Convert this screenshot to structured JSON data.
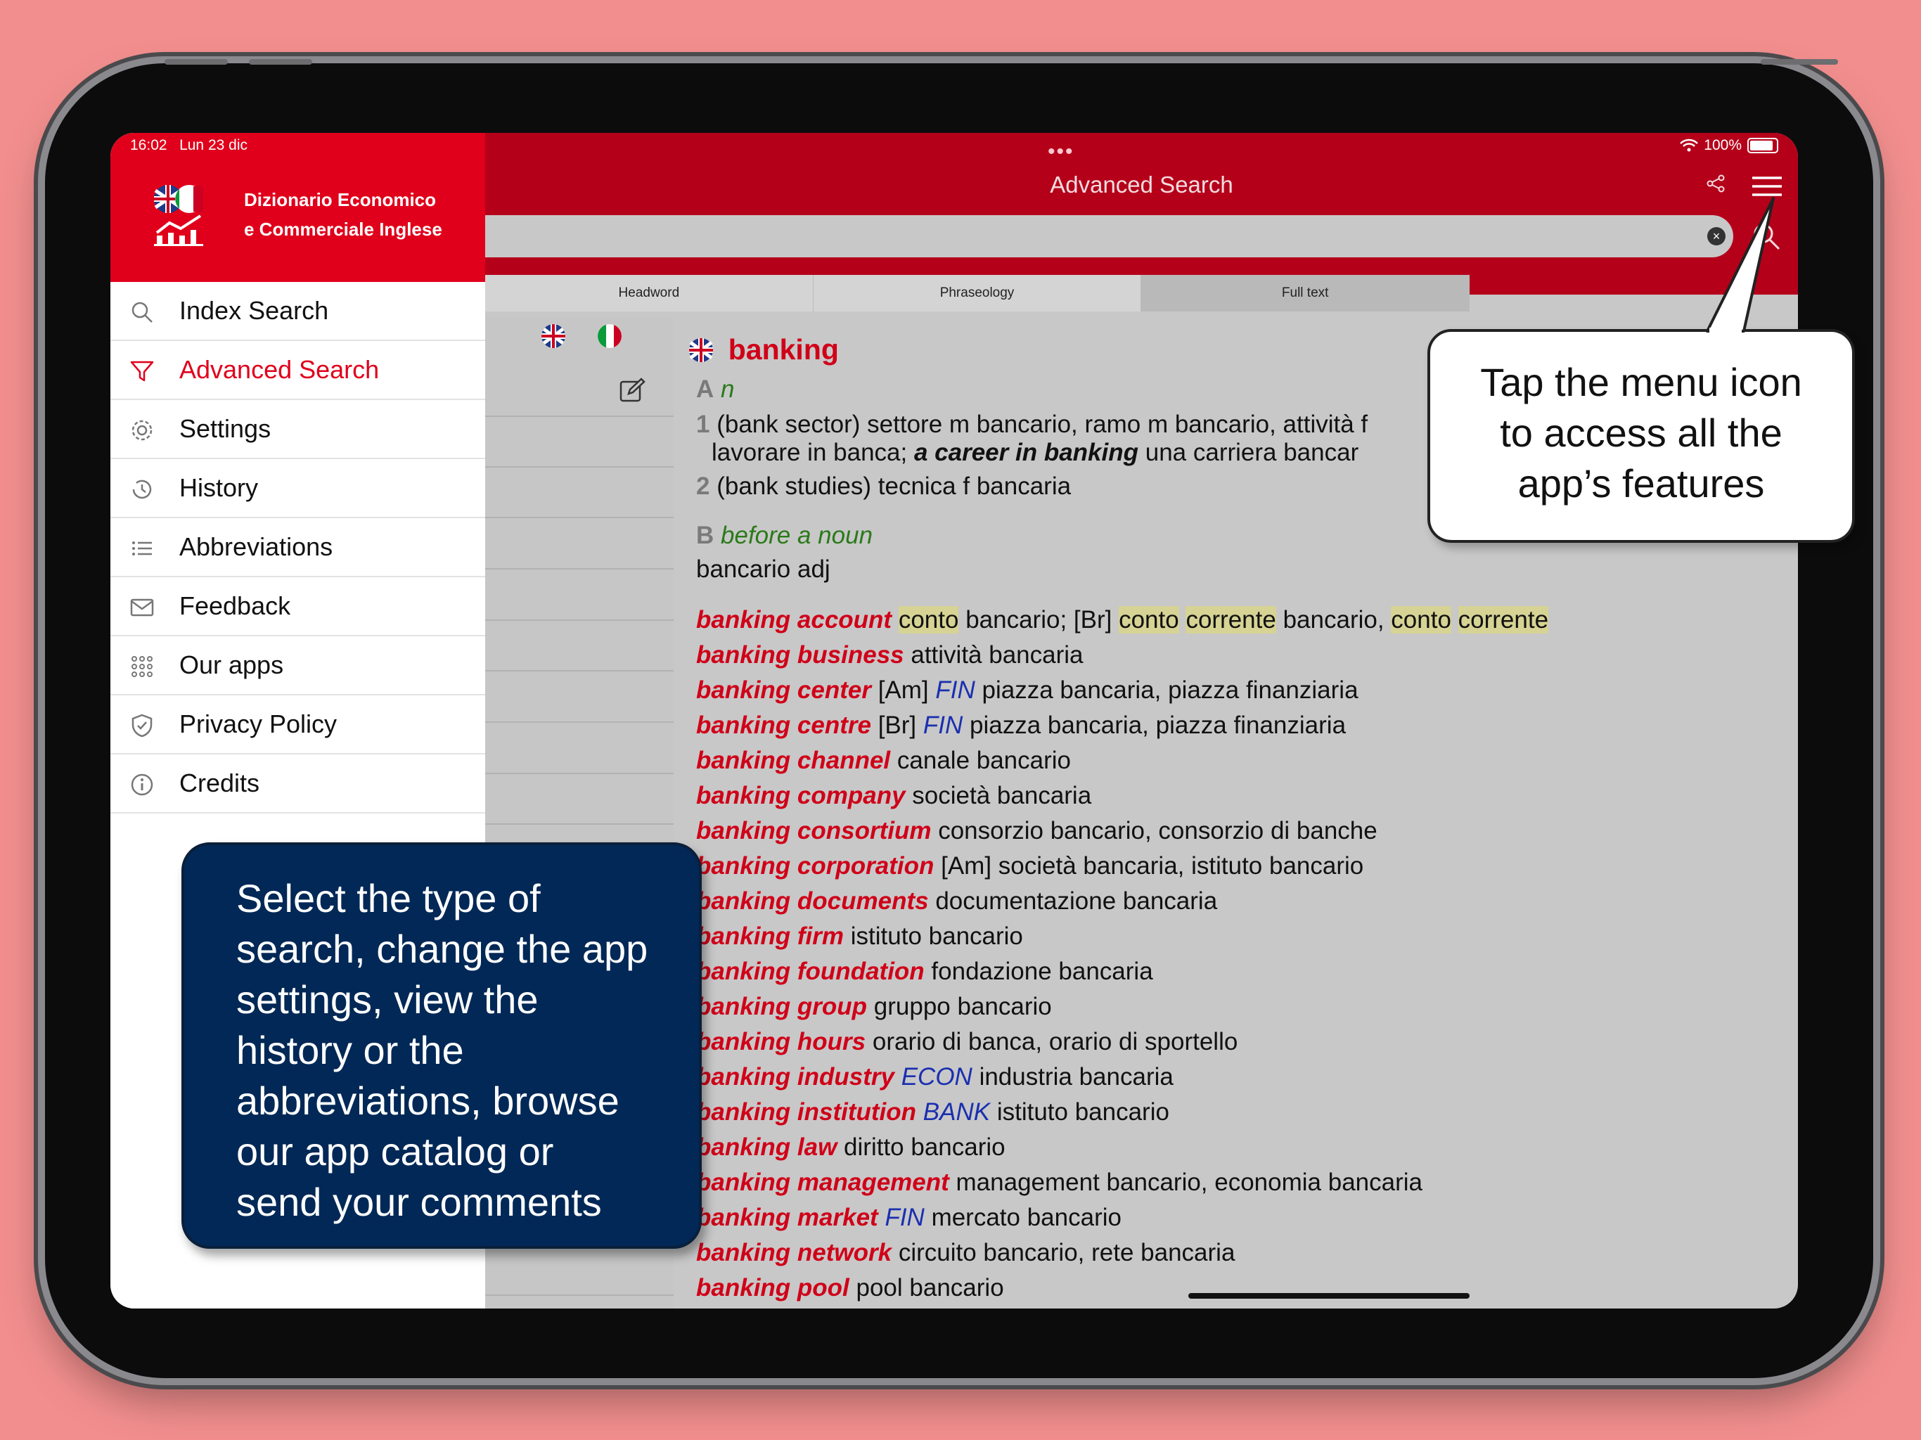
{
  "status": {
    "time": "16:02",
    "date": "Lun 23 dic",
    "dots": "•••",
    "battery": "100%"
  },
  "app": {
    "name_line1": "Dizionario Economico",
    "name_line2": "e Commerciale Inglese"
  },
  "sidebar": {
    "items": [
      {
        "label": "Index Search",
        "icon": "search-icon"
      },
      {
        "label": "Advanced Search",
        "icon": "filter-icon",
        "active": true
      },
      {
        "label": "Settings",
        "icon": "gear-icon"
      },
      {
        "label": "History",
        "icon": "history-icon"
      },
      {
        "label": "Abbreviations",
        "icon": "list-icon"
      },
      {
        "label": "Feedback",
        "icon": "mail-icon"
      },
      {
        "label": "Our apps",
        "icon": "grid-icon"
      },
      {
        "label": "Privacy Policy",
        "icon": "shield-icon"
      },
      {
        "label": "Credits",
        "icon": "info-icon"
      }
    ]
  },
  "header": {
    "title": "Advanced Search"
  },
  "search": {
    "value": "",
    "placeholder": ""
  },
  "tabs": [
    {
      "label": "Headword",
      "selected": false
    },
    {
      "label": "Phraseology",
      "selected": false
    },
    {
      "label": "Full text",
      "selected": true
    }
  ],
  "entry": {
    "headword": "banking",
    "sectA_letter": "A",
    "sectA_pos": "n",
    "s1_num": "1",
    "s1_text": "(bank sector) settore m bancario, ramo m bancario, attività f",
    "s1b_pre": "lavorare in banca;",
    "s1b_phrase": "a career in banking",
    "s1b_post": "una carriera bancar",
    "s2_num": "2",
    "s2_text": "(bank studies) tecnica f bancaria",
    "sectB_letter": "B",
    "sectB_pos": "before a noun",
    "sectB_text": "bancario adj",
    "phrase1_head": "banking account",
    "phrase1_w1": "conto",
    "phrase1_t1": "bancario; [Br]",
    "phrase1_w2": "conto",
    "phrase1_w3": "corrente",
    "phrase1_t2": "bancario,",
    "phrase1_w4": "conto",
    "phrase1_w5": "corrente",
    "phrases": [
      {
        "head": "banking business",
        "tag": "",
        "text": "attività bancaria"
      },
      {
        "head": "banking center",
        "tag": "FIN",
        "pre": "[Am]",
        "text": "piazza bancaria, piazza finanziaria"
      },
      {
        "head": "banking centre",
        "tag": "FIN",
        "pre": "[Br]",
        "text": "piazza bancaria, piazza finanziaria"
      },
      {
        "head": "banking channel",
        "tag": "",
        "text": "canale bancario"
      },
      {
        "head": "banking company",
        "tag": "",
        "text": "società bancaria"
      },
      {
        "head": "banking consortium",
        "tag": "",
        "text": "consorzio bancario, consorzio di banche"
      },
      {
        "head": "banking corporation",
        "tag": "",
        "pre": "[Am]",
        "text": "società bancaria, istituto bancario"
      },
      {
        "head": "banking documents",
        "tag": "",
        "text": "documentazione bancaria"
      },
      {
        "head": "banking firm",
        "tag": "",
        "text": "istituto bancario"
      },
      {
        "head": "banking foundation",
        "tag": "",
        "text": "fondazione bancaria"
      },
      {
        "head": "banking group",
        "tag": "",
        "text": "gruppo bancario"
      },
      {
        "head": "banking hours",
        "tag": "",
        "text": "orario di banca, orario di sportello"
      },
      {
        "head": "banking industry",
        "tag": "ECON",
        "text": "industria bancaria"
      },
      {
        "head": "banking institution",
        "tag": "BANK",
        "text": "istituto bancario"
      },
      {
        "head": "banking law",
        "tag": "",
        "text": "diritto bancario"
      },
      {
        "head": "banking management",
        "tag": "",
        "text": "management bancario, economia bancaria"
      },
      {
        "head": "banking market",
        "tag": "FIN",
        "text": "mercato bancario"
      },
      {
        "head": "banking network",
        "tag": "",
        "text": "circuito bancario, rete bancaria"
      },
      {
        "head": "banking pool",
        "tag": "",
        "text": "pool bancario"
      }
    ]
  },
  "callouts": {
    "right": [
      "Tap the menu icon",
      "to access all the",
      "app’s features"
    ],
    "left": [
      "Select the type of",
      "search, change the app",
      "settings, view the",
      "history or the",
      "abbreviations, browse",
      "our app catalog or",
      "send your comments"
    ]
  },
  "colors": {
    "brand_red": "#e0001b",
    "header_red": "#b5001a",
    "callout_navy": "#012856",
    "background": "#f28f8e"
  }
}
